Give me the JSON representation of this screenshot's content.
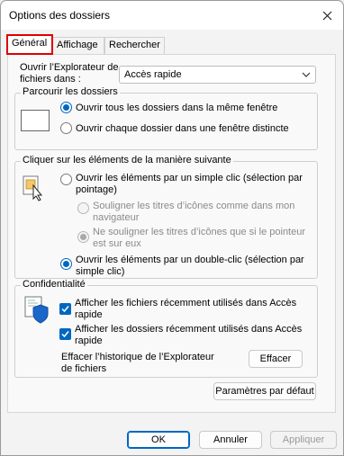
{
  "window": {
    "title": "Options des dossiers"
  },
  "tabs": [
    {
      "label": "Général"
    },
    {
      "label": "Affichage"
    },
    {
      "label": "Rechercher"
    }
  ],
  "open_explorer": {
    "label": "Ouvrir l’Explorateur de fichiers dans :",
    "selected": "Accès rapide"
  },
  "browse_folders": {
    "title": "Parcourir les dossiers",
    "options": [
      {
        "label": "Ouvrir tous les dossiers dans la même fenêtre",
        "selected": true
      },
      {
        "label": "Ouvrir chaque dossier dans une fenêtre distincte",
        "selected": false
      }
    ]
  },
  "click_items": {
    "title": "Cliquer sur les éléments de la manière suivante",
    "single_click": {
      "label": "Ouvrir les éléments par un simple clic (sélection par pointage)",
      "selected": false
    },
    "underline_options": [
      {
        "label": "Souligner les titres d’icônes comme dans mon navigateur"
      },
      {
        "label": "Ne souligner les titres d’icônes que si le pointeur est sur eux",
        "selected": true
      }
    ],
    "double_click": {
      "label": "Ouvrir les éléments par un double-clic (sélection par simple clic)",
      "selected": true
    }
  },
  "privacy": {
    "title": "Confidentialité",
    "checkboxes": [
      {
        "label": "Afficher les fichiers récemment utilisés dans Accès rapide",
        "checked": true
      },
      {
        "label": "Afficher les dossiers récemment utilisés dans Accès rapide",
        "checked": true
      }
    ],
    "clear_label": "Effacer l’historique de l’Explorateur de fichiers",
    "clear_button": "Effacer"
  },
  "restore_defaults": "Paramètres par défaut",
  "footer": {
    "ok": "OK",
    "cancel": "Annuler",
    "apply": "Appliquer"
  },
  "colors": {
    "accent": "#0067c0",
    "tab_highlight": "#e00000"
  },
  "icons": {
    "close": "close-icon",
    "dropdown": "chevron-down-icon",
    "folder_window": "window-icon",
    "cursor": "single-click-icon",
    "privacy": "privacy-shield-icon"
  }
}
